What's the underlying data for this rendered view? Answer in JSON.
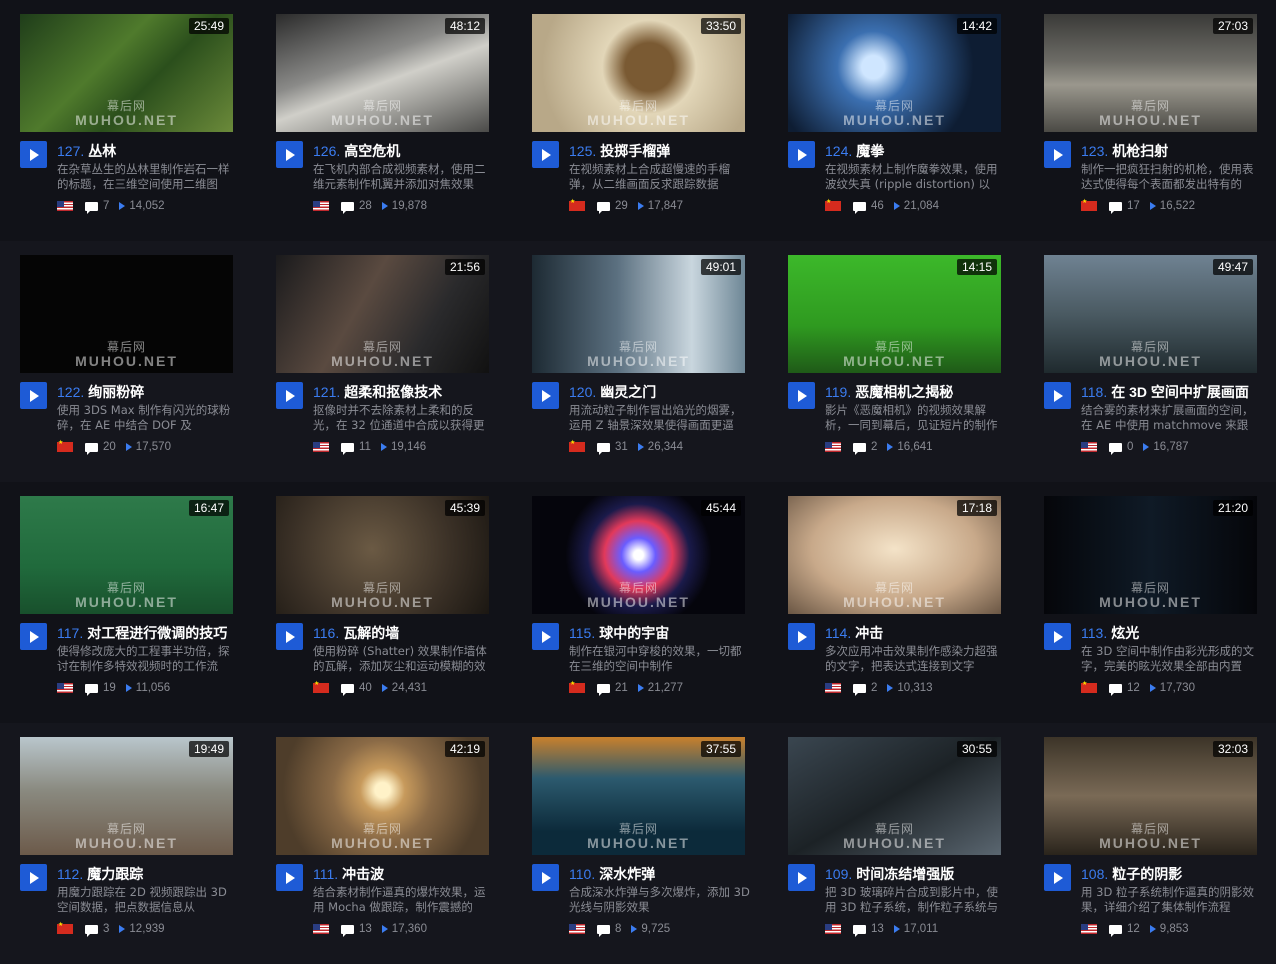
{
  "watermark": {
    "cn": "幕后网",
    "en": "MUHOU.NET"
  },
  "colors": {
    "accent": "#1e5bd6",
    "number": "#3b7cf0",
    "background": "#111218"
  },
  "rows": [
    {
      "cards": [
        {
          "duration": "25:49",
          "num": "127.",
          "title": "丛林",
          "desc": "在杂草丛生的丛林里制作岩石一样的标题，在三维空间使用二维图",
          "flag": "us",
          "comments": "7",
          "views": "14,052",
          "thumb": "linear-gradient(135deg,#1f3d1a,#4f7a2c 40%,#2b4f1c 60%,#6b8a3a)"
        },
        {
          "duration": "48:12",
          "num": "126.",
          "title": "高空危机",
          "desc": "在飞机内部合成视频素材，使用二维元素制作机翼并添加对焦效果",
          "flag": "us",
          "comments": "28",
          "views": "19,878",
          "thumb": "linear-gradient(160deg,#2b2b2b,#8a8a88 40%,#d0cfc9 55%,#4a4a48)"
        },
        {
          "duration": "33:50",
          "num": "125.",
          "title": "投掷手榴弹",
          "desc": "在视频素材上合成超慢速的手榴弹，从二维画面反求跟踪数据",
          "flag": "cn",
          "comments": "29",
          "views": "17,847",
          "thumb": "radial-gradient(circle at 55% 45%,#7a5a33 0 18%,#e2d6b8 35%,#b8a888 80%)"
        },
        {
          "duration": "14:42",
          "num": "124.",
          "title": "魔拳",
          "desc": "在视频素材上制作魔拳效果，使用波纹失真 (ripple distortion) 以",
          "flag": "cn",
          "comments": "46",
          "views": "21,084",
          "thumb": "radial-gradient(circle at 40% 45%,#cfe6ff 0 8%,#3b6fb0 25%,#0e1d33 70%)"
        },
        {
          "duration": "27:03",
          "num": "123.",
          "title": "机枪扫射",
          "desc": "制作一把疯狂扫射的机枪，使用表达式使得每个表面都发出特有的",
          "flag": "cn",
          "comments": "17",
          "views": "16,522",
          "thumb": "linear-gradient(180deg,#3a3a38,#6d6c66 40%,#9a978d 60%,#4b4a45)"
        }
      ]
    },
    {
      "cards": [
        {
          "duration": "",
          "num": "122.",
          "title": "绚丽粉碎",
          "desc": "使用 3DS Max 制作有闪光的球粉碎，在 AE 中结合 DOF 及",
          "flag": "cn",
          "comments": "20",
          "views": "17,570",
          "thumb": "#050505"
        },
        {
          "duration": "21:56",
          "num": "121.",
          "title": "超柔和抠像技术",
          "desc": "抠像时并不去除素材上柔和的反光，在 32 位通道中合成以获得更",
          "flag": "us",
          "comments": "11",
          "views": "19,146",
          "thumb": "linear-gradient(120deg,#1a1a1c,#5a4a40 40%,#2a2a2c 70%,#111)"
        },
        {
          "duration": "49:01",
          "num": "120.",
          "title": "幽灵之门",
          "desc": "用流动粒子制作冒出焰光的烟雾，运用 Z 轴景深效果使得画面更逼",
          "flag": "cn",
          "comments": "31",
          "views": "26,344",
          "thumb": "linear-gradient(90deg,#1d2a33,#5b7080 40%,#c9d6de 75%,#6e8796)"
        },
        {
          "duration": "14:15",
          "num": "119.",
          "title": "恶魔相机之揭秘",
          "desc": "影片《恶魔相机》的视频效果解析，一同到幕后，见证短片的制作",
          "flag": "us",
          "comments": "2",
          "views": "16,641",
          "thumb": "linear-gradient(180deg,#3cb82a,#2f9a20 60%,#1f5a18)"
        },
        {
          "duration": "49:47",
          "num": "118.",
          "title": "在 3D 空间中扩展画面",
          "desc": "结合雾的素材来扩展画面的空间，在 AE 中使用 matchmove 来跟",
          "flag": "us",
          "comments": "0",
          "views": "16,787",
          "thumb": "linear-gradient(180deg,#6f8292,#4a5a62 50%,#1f2a2e)"
        }
      ]
    },
    {
      "cards": [
        {
          "duration": "16:47",
          "num": "117.",
          "title": "对工程进行微调的技巧",
          "desc": "使得修改庞大的工程事半功倍，探讨在制作多特效视频时的工作流",
          "flag": "us",
          "comments": "19",
          "views": "11,056",
          "thumb": "linear-gradient(180deg,#2e7a4a,#206a3c 60%,#18502c)"
        },
        {
          "duration": "45:39",
          "num": "116.",
          "title": "瓦解的墙",
          "desc": "使用粉碎 (Shatter) 效果制作墙体的瓦解，添加灰尘和运动模糊的效",
          "flag": "cn",
          "comments": "40",
          "views": "24,431",
          "thumb": "radial-gradient(circle at 45% 45%,#6b5a44,#3a3026 60%,#1b1712)"
        },
        {
          "duration": "45:44",
          "num": "115.",
          "title": "球中的宇宙",
          "desc": "制作在银河中穿梭的效果，一切都在三维的空间中制作",
          "flag": "cn",
          "comments": "21",
          "views": "21,277",
          "thumb": "radial-gradient(circle at 50% 50%,#ffffff 0 4%,#6a5cff 14%,#e2395a 28%,#1a1a4a 42%,#05050c 60%)"
        },
        {
          "duration": "17:18",
          "num": "114.",
          "title": "冲击",
          "desc": "多次应用冲击效果制作感染力超强的文字，把表达式连接到文字",
          "flag": "us",
          "comments": "2",
          "views": "10,313",
          "thumb": "radial-gradient(ellipse at 50% 45%,#f4e3c8,#c8a98a 55%,#6a5644)"
        },
        {
          "duration": "21:20",
          "num": "113.",
          "title": "炫光",
          "desc": "在 3D 空间中制作由彩光形成的文字，完美的眩光效果全部由内置",
          "flag": "cn",
          "comments": "12",
          "views": "17,730",
          "thumb": "linear-gradient(90deg,#05060a,#0f1a26 50%,#05060a)"
        }
      ]
    },
    {
      "cards": [
        {
          "duration": "19:49",
          "num": "112.",
          "title": "魔力跟踪",
          "desc": "用魔力跟踪在 2D 视频跟踪出 3D 空间数据，把点数据信息从",
          "flag": "cn",
          "comments": "3",
          "views": "12,939",
          "thumb": "linear-gradient(180deg,#b9c6cc,#8a8a80 45%,#6c5a4a)"
        },
        {
          "duration": "42:19",
          "num": "111.",
          "title": "冲击波",
          "desc": "结合素材制作逼真的爆炸效果，运用 Mocha 做跟踪，制作震撼的",
          "flag": "us",
          "comments": "13",
          "views": "17,360",
          "thumb": "radial-gradient(circle at 50% 45%,#fff2c8 0 6%,#c79a5c 18%,#8a6a46 40%,#4e3d2a 80%)"
        },
        {
          "duration": "37:55",
          "num": "110.",
          "title": "深水炸弹",
          "desc": "合成深水炸弹与多次爆炸，添加 3D 光线与阴影效果",
          "flag": "us",
          "comments": "8",
          "views": "9,725",
          "thumb": "linear-gradient(180deg,#c8802c,#2c5a6e 35%,#0c2a3a 80%)"
        },
        {
          "duration": "30:55",
          "num": "109.",
          "title": "时间冻结增强版",
          "desc": "把 3D 玻璃碎片合成到影片中，使用 3D 粒子系统，制作粒子系统与",
          "flag": "us",
          "comments": "13",
          "views": "17,011",
          "thumb": "linear-gradient(150deg,#3a4650,#1c2226 50%,#5a6670)"
        },
        {
          "duration": "32:03",
          "num": "108.",
          "title": "粒子的阴影",
          "desc": "用 3D 粒子系统制作逼真的阴影效果，详细介绍了集体制作流程",
          "flag": "us",
          "comments": "12",
          "views": "9,853",
          "thumb": "linear-gradient(180deg,#3c3428,#7a6a56 50%,#2a241c)"
        }
      ]
    }
  ]
}
